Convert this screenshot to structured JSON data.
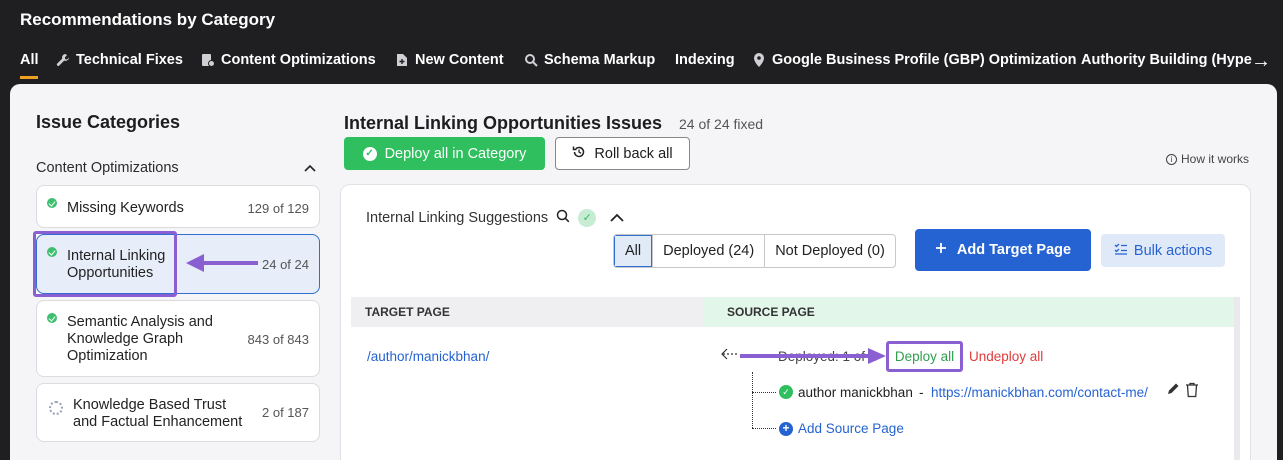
{
  "header": {
    "title": "Recommendations by Category"
  },
  "tabs": [
    {
      "label": "All",
      "icon": ""
    },
    {
      "label": "Technical Fixes",
      "icon": "wrench-icon"
    },
    {
      "label": "Content Optimizations",
      "icon": "document-check-icon"
    },
    {
      "label": "New Content",
      "icon": "new-document-icon"
    },
    {
      "label": "Schema Markup",
      "icon": "search-schema-icon"
    },
    {
      "label": "Indexing",
      "icon": ""
    },
    {
      "label": "Google Business Profile (GBP) Optimization",
      "icon": "location-pin-icon"
    },
    {
      "label": "Authority Building (Hype",
      "icon": ""
    }
  ],
  "sidebar": {
    "title": "Issue Categories",
    "group_label": "Content Optimizations",
    "items": [
      {
        "label": "Missing Keywords",
        "count": "129 of 129",
        "status": "complete"
      },
      {
        "label": "Internal Linking Opportunities",
        "count": "24 of 24",
        "status": "complete"
      },
      {
        "label": "Semantic Analysis and Knowledge Graph Optimization",
        "count": "843 of 843",
        "status": "complete"
      },
      {
        "label": "Knowledge Based Trust and Factual Enhancement",
        "count": "2 of 187",
        "status": "in-progress"
      }
    ]
  },
  "main": {
    "title": "Internal Linking Opportunities Issues",
    "subtitle": "24 of 24 fixed",
    "deploy_category_label": "Deploy all in Category",
    "rollback_label": "Roll back all",
    "how_it_works": "How it works",
    "suggestions_title": "Internal Linking Suggestions",
    "filters": [
      "All",
      "Deployed (24)",
      "Not Deployed (0)"
    ],
    "add_target_label": "Add Target Page",
    "bulk_actions_label": "Bulk actions",
    "table": {
      "col_target": "TARGET PAGE",
      "col_source": "SOURCE PAGE",
      "row": {
        "target": "/author/manickbhan/",
        "deployed": "Deployed: 1 of 1",
        "deploy_all": "Deploy all",
        "undeploy_all": "Undeploy all",
        "source_anchor": "author manickbhan",
        "source_sep": "-",
        "source_url": "https://manickbhan.com/contact-me/",
        "add_source": "Add Source Page"
      }
    }
  },
  "colors": {
    "accent_blue": "#2563d3",
    "success_green": "#2fbf5e",
    "danger_red": "#e03b3b",
    "annotation_purple": "#8a5fd1"
  }
}
